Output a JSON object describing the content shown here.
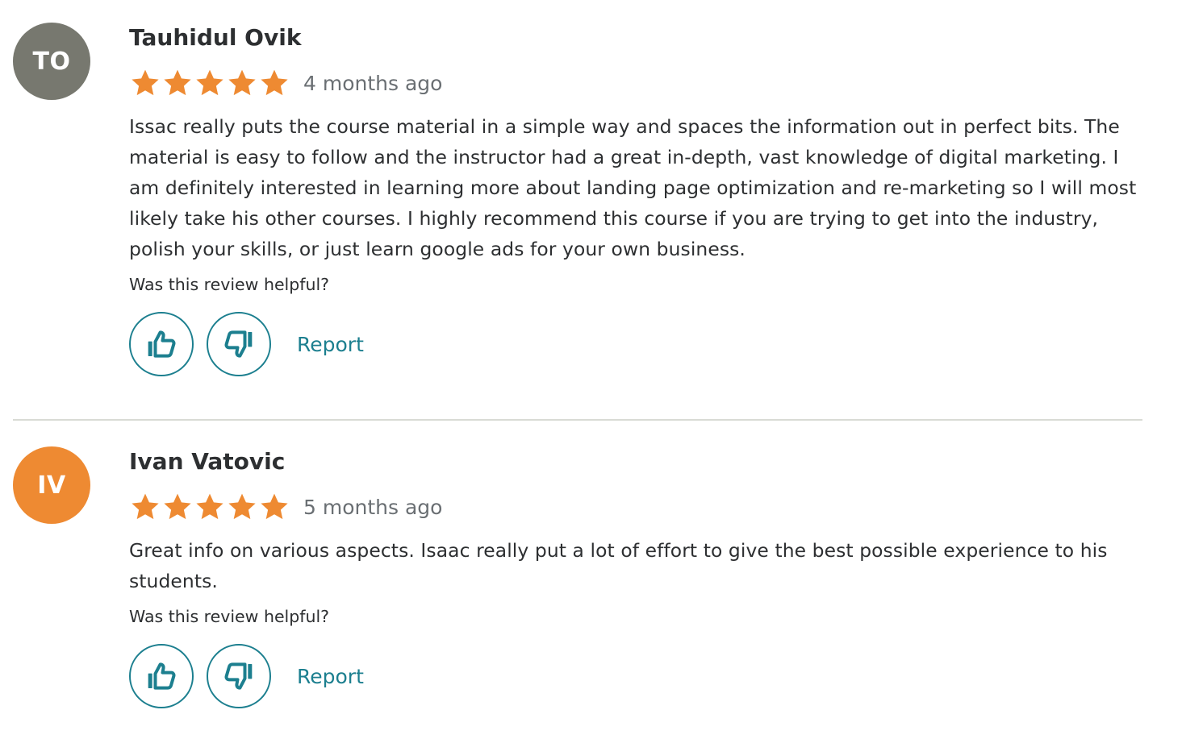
{
  "reviews": [
    {
      "initials": "TO",
      "avatar_color": "#77786f",
      "name": "Tauhidul Ovik",
      "rating": 5,
      "time": "4 months ago",
      "comment": "Issac really puts the course material in a simple way and spaces the information out in perfect bits. The material is easy to follow and the instructor had a great in-depth, vast knowledge of digital marketing. I am definitely interested in learning more about landing page optimization and re-marketing so I will most likely take his other courses. I highly recommend this course if you are trying to get into the industry, polish your skills, or just learn google ads for your own business.",
      "helpful_prompt": "Was this review helpful?",
      "report_label": "Report"
    },
    {
      "initials": "IV",
      "avatar_color": "#ee8a32",
      "name": "Ivan Vatovic",
      "rating": 5,
      "time": "5 months ago",
      "comment": "Great info on various aspects. Isaac really put a lot of effort to give the best possible experience to his students.",
      "helpful_prompt": "Was this review helpful?",
      "report_label": "Report"
    }
  ],
  "colors": {
    "star": "#ee8a32",
    "accent": "#1c7f8f",
    "divider": "#d9dbd5"
  },
  "icons": {
    "star": "star-icon",
    "thumbs_up": "thumbs-up-icon",
    "thumbs_down": "thumbs-down-icon"
  }
}
